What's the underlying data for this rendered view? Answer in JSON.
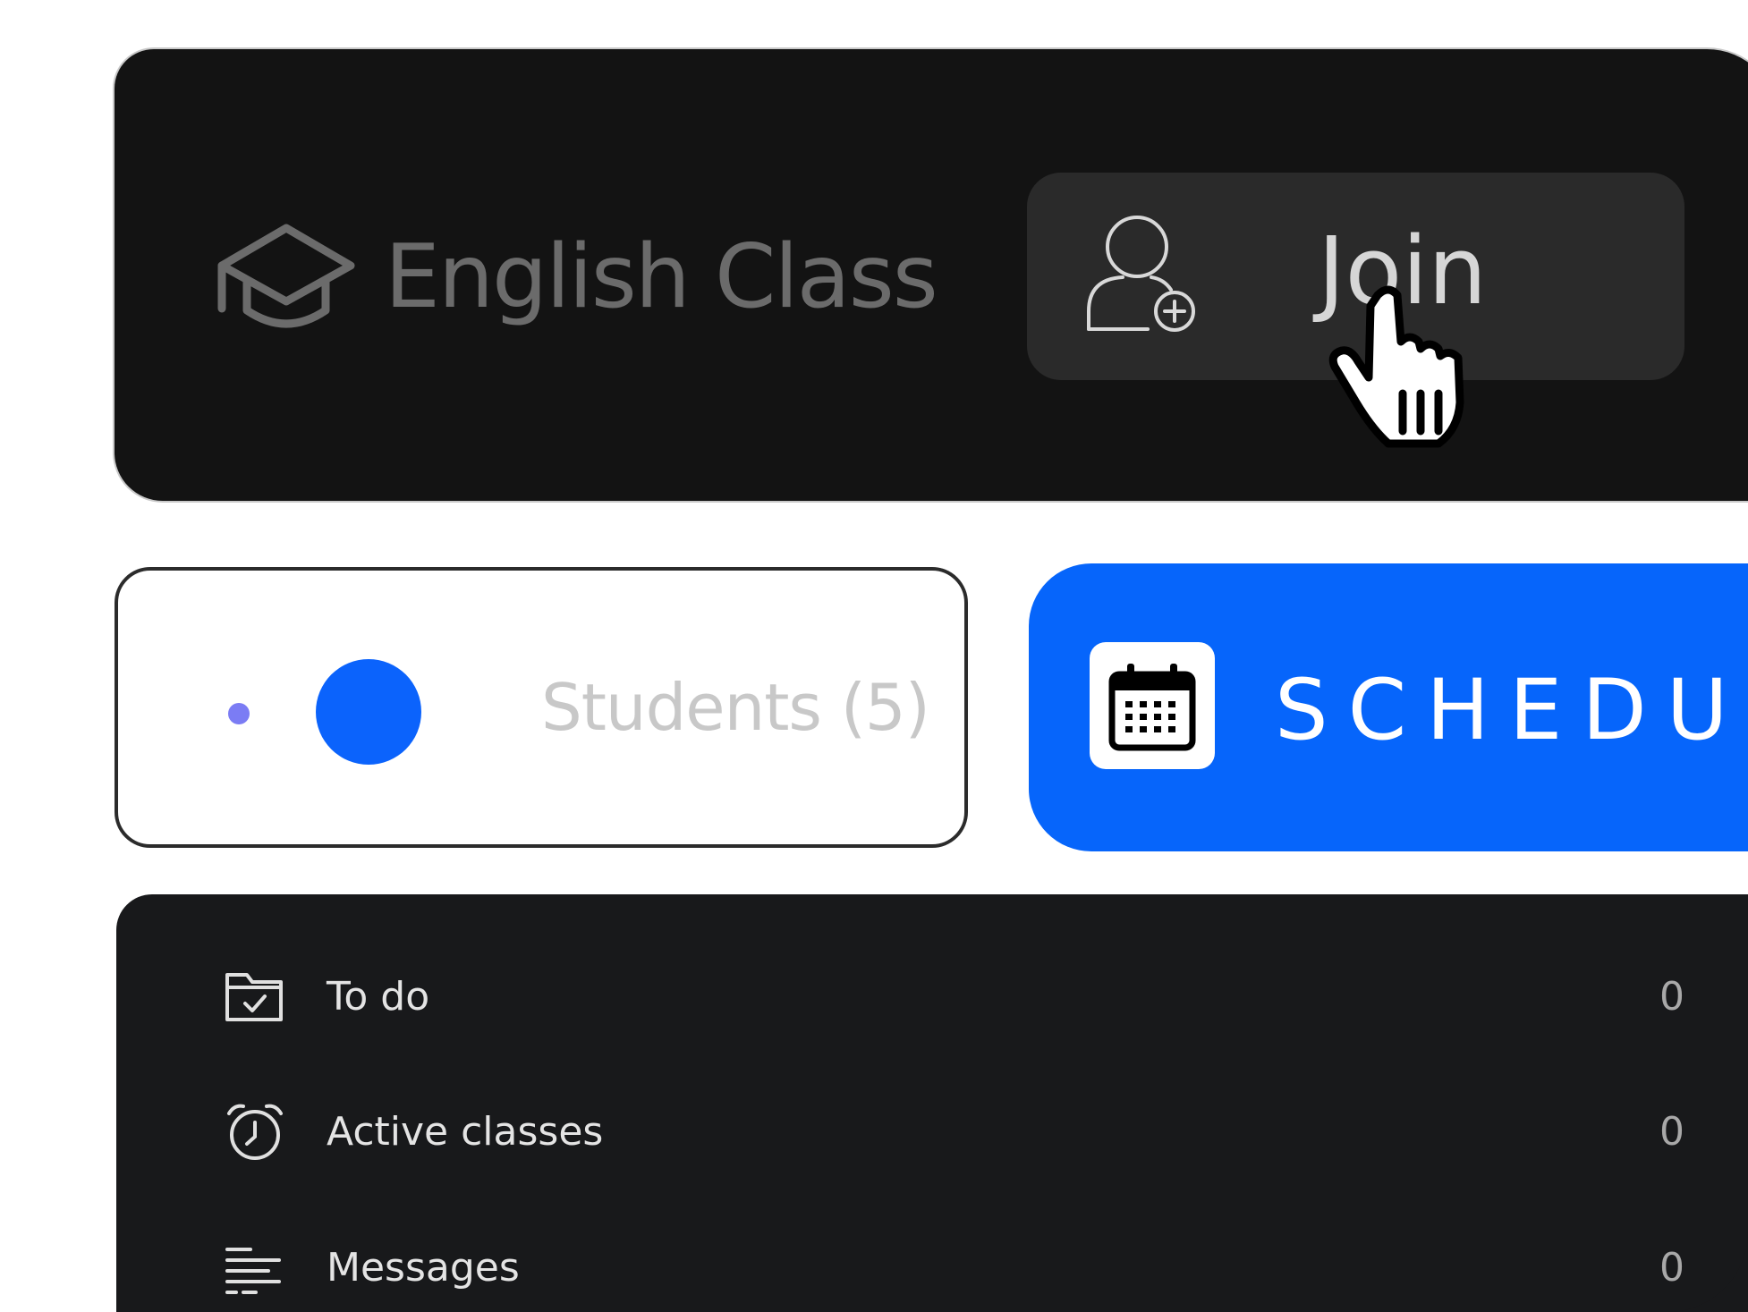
{
  "header": {
    "class_title": "English Class",
    "class_icon": "graduation-cap-icon",
    "join_button": {
      "label": "Join",
      "icon": "add-user-icon"
    }
  },
  "students": {
    "label": "Students (5)",
    "colors": {
      "small_dot": "#7b7cf4",
      "large_dot": "#0b63fc"
    }
  },
  "schedule_button": {
    "label": "SCHEDULE",
    "icon": "calendar-icon",
    "color": "#0665fb"
  },
  "stats": [
    {
      "icon": "folder-check-icon",
      "label": "To do",
      "value": "0"
    },
    {
      "icon": "alarm-clock-icon",
      "label": "Active classes",
      "value": "0"
    },
    {
      "icon": "text-lines-icon",
      "label": "Messages",
      "value": "0"
    }
  ]
}
